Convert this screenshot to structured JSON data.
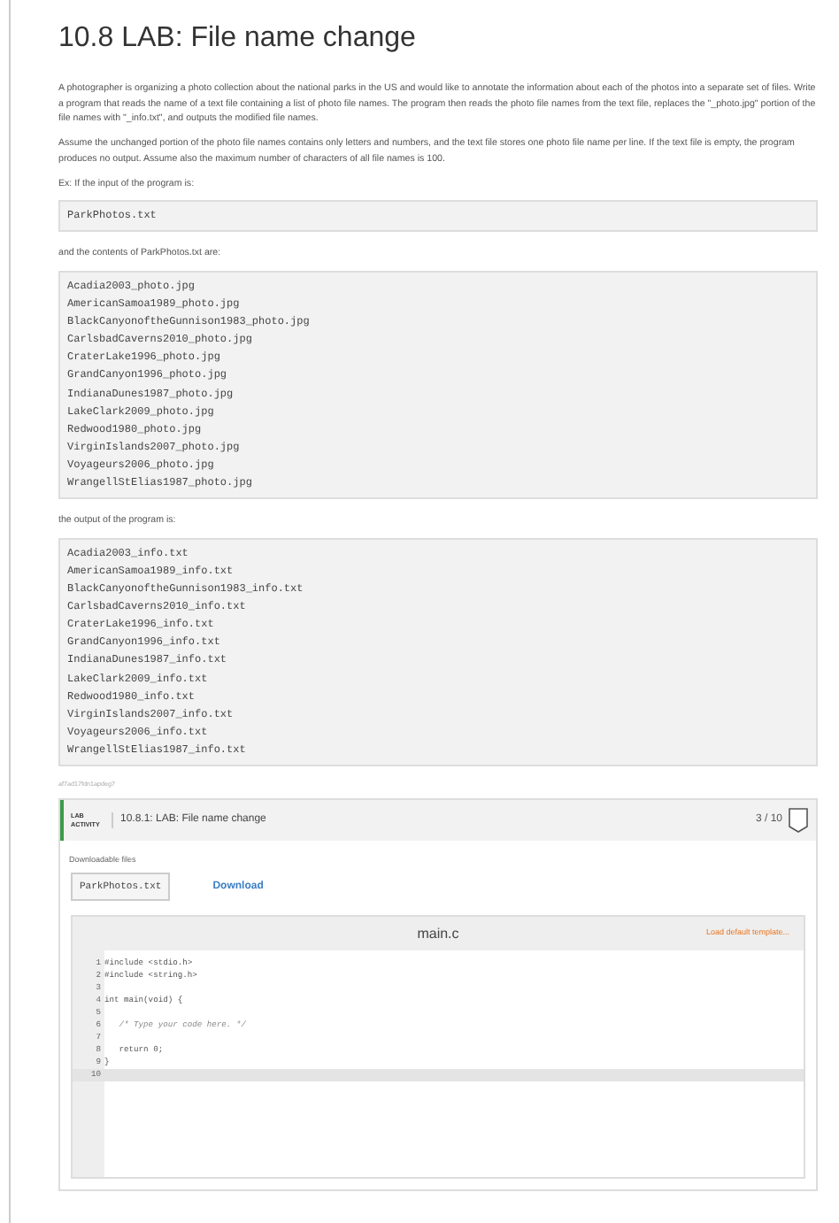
{
  "title": "10.8 LAB: File name change",
  "paragraphs": [
    "A photographer is organizing a photo collection about the national parks in the US and would like to annotate the information about each of the photos into a separate set of files. Write a program that reads the name of a text file containing a list of photo file names. The program then reads the photo file names from the text file, replaces the \"_photo.jpg\" portion of the file names with \"_info.txt\", and outputs the modified file names.",
    "Assume the unchanged portion of the photo file names contains only letters and numbers, and the text file stores one photo file name per line. If the text file is empty, the program produces no output. Assume also the maximum number of characters of all file names is 100.",
    "Ex: If the input of the program is:"
  ],
  "input_example": "ParkPhotos.txt",
  "contents_label": "and the contents of ParkPhotos.txt are:",
  "contents": [
    "Acadia2003_photo.jpg",
    "AmericanSamoa1989_photo.jpg",
    "BlackCanyonoftheGunnison1983_photo.jpg",
    "CarlsbadCaverns2010_photo.jpg",
    "CraterLake1996_photo.jpg",
    "GrandCanyon1996_photo.jpg",
    "IndianaDunes1987_photo.jpg",
    "LakeClark2009_photo.jpg",
    "Redwood1980_photo.jpg",
    "VirginIslands2007_photo.jpg",
    "Voyageurs2006_photo.jpg",
    "WrangellStElias1987_photo.jpg"
  ],
  "output_label": "the output of the program is:",
  "output": [
    "Acadia2003_info.txt",
    "AmericanSamoa1989_info.txt",
    "BlackCanyonoftheGunnison1983_info.txt",
    "CarlsbadCaverns2010_info.txt",
    "CraterLake1996_info.txt",
    "GrandCanyon1996_info.txt",
    "IndianaDunes1987_info.txt",
    "LakeClark2009_info.txt",
    "Redwood1980_info.txt",
    "VirginIslands2007_info.txt",
    "Voyageurs2006_info.txt",
    "WrangellStElias1987_info.txt"
  ],
  "content_id": "af7ad17fdn1apdeg7",
  "lab": {
    "label": "LAB ACTIVITY",
    "title": "10.8.1: LAB: File name change",
    "score": "3 / 10",
    "downloads_label": "Downloadable files",
    "file": "ParkPhotos.txt",
    "download": "Download",
    "editor": {
      "filename": "main.c",
      "template_link": "Load default template...",
      "lines": [
        {
          "number": "1",
          "code": "#include <stdio.h>",
          "kind": "code",
          "selected": false
        },
        {
          "number": "2",
          "code": "#include <string.h>",
          "kind": "code",
          "selected": false
        },
        {
          "number": "3",
          "selected": false
        },
        {
          "number": "4",
          "code": "int main(void) {",
          "kind": "code",
          "selected": false
        },
        {
          "number": "5",
          "selected": false
        },
        {
          "number": "6",
          "code": "   /* Type your code here. */",
          "kind": "comment",
          "selected": false
        },
        {
          "number": "7",
          "selected": false
        },
        {
          "number": "8",
          "code": "   return 0;",
          "kind": "code",
          "selected": false
        },
        {
          "number": "9",
          "code": "}",
          "kind": "code",
          "selected": false
        },
        {
          "number": "10",
          "selected": true
        }
      ]
    }
  }
}
